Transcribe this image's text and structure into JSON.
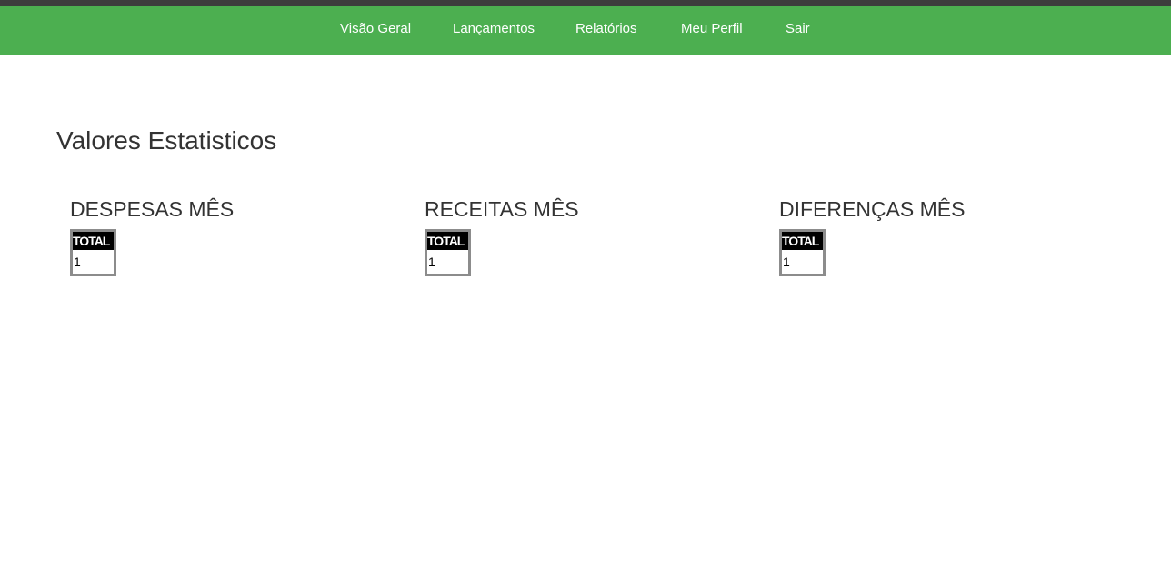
{
  "nav": {
    "items": [
      {
        "label": "Visão Geral"
      },
      {
        "label": "Lançamentos"
      },
      {
        "label": "Relatórios"
      },
      {
        "label": "Meu Perfil"
      },
      {
        "label": "Sair"
      }
    ]
  },
  "page": {
    "title": "Valores Estatisticos"
  },
  "stats": [
    {
      "heading": "DESPESAS MÊS",
      "column": "TOTAL",
      "value": "1"
    },
    {
      "heading": "RECEITAS MÊS",
      "column": "TOTAL",
      "value": "1"
    },
    {
      "heading": "DIFERENÇAS MÊS",
      "column": "TOTAL",
      "value": "1"
    }
  ],
  "colors": {
    "navbar": "#4caf50",
    "top_strip": "#3d3d3d",
    "text": "#333333"
  }
}
